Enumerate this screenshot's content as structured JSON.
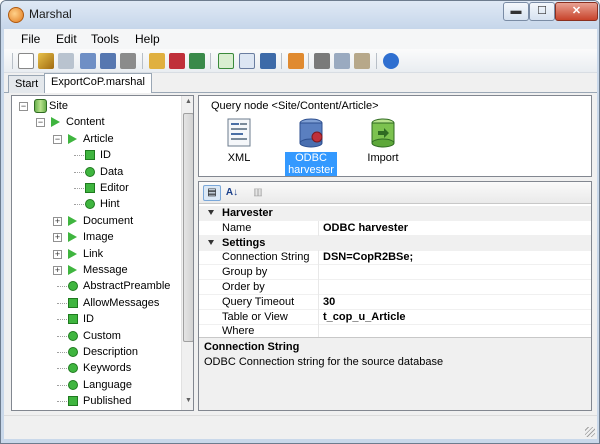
{
  "window": {
    "title": "Marshal",
    "minimize_glyph": "▬",
    "maximize_glyph": "☐",
    "close_glyph": "✕"
  },
  "menu": [
    "File",
    "Edit",
    "Tools",
    "Help"
  ],
  "toolbar_icons": [
    "new-icon",
    "wand-icon",
    "open-icon",
    "save-icon",
    "save-all-icon",
    "print-icon",
    "settings-icon",
    "cube-run-icon",
    "forward-icon",
    "export-xml-icon",
    "export-icon",
    "console-icon",
    "configure-icon",
    "cut-icon",
    "copy-icon",
    "paste-icon",
    "help-icon"
  ],
  "tabs": [
    "Start",
    "ExportCoP.marshal"
  ],
  "tree": {
    "items": [
      {
        "label": "Site",
        "icon": "database-icon",
        "level": 0,
        "expander": "−"
      },
      {
        "label": "Content",
        "icon": "play-icon",
        "level": 1,
        "expander": "−"
      },
      {
        "label": "Article",
        "icon": "play-icon",
        "level": 2,
        "expander": "−"
      },
      {
        "label": "ID",
        "icon": "square-icon",
        "level": 3,
        "expander": ""
      },
      {
        "label": "Data",
        "icon": "dot-icon",
        "level": 3,
        "expander": ""
      },
      {
        "label": "Editor",
        "icon": "square-icon",
        "level": 3,
        "expander": ""
      },
      {
        "label": "Hint",
        "icon": "dot-icon",
        "level": 3,
        "expander": ""
      },
      {
        "label": "Document",
        "icon": "play-icon",
        "level": 2,
        "expander": "+"
      },
      {
        "label": "Image",
        "icon": "play-icon",
        "level": 2,
        "expander": "+"
      },
      {
        "label": "Link",
        "icon": "play-icon",
        "level": 2,
        "expander": "+"
      },
      {
        "label": "Message",
        "icon": "play-icon",
        "level": 2,
        "expander": "+"
      },
      {
        "label": "AbstractPreamble",
        "icon": "dot-icon",
        "level": 2,
        "expander": ""
      },
      {
        "label": "AllowMessages",
        "icon": "square-icon",
        "level": 2,
        "expander": ""
      },
      {
        "label": "ID",
        "icon": "square-icon",
        "level": 2,
        "expander": ""
      },
      {
        "label": "Custom",
        "icon": "dot-icon",
        "level": 2,
        "expander": ""
      },
      {
        "label": "Description",
        "icon": "dot-icon",
        "level": 2,
        "expander": ""
      },
      {
        "label": "Keywords",
        "icon": "dot-icon",
        "level": 2,
        "expander": ""
      },
      {
        "label": "Language",
        "icon": "dot-icon",
        "level": 2,
        "expander": ""
      },
      {
        "label": "Published",
        "icon": "square-icon",
        "level": 2,
        "expander": ""
      }
    ],
    "scroll_up_glyph": "▲",
    "scroll_down_glyph": "▼"
  },
  "query_node": {
    "title": "Query node <Site/Content/Article>",
    "items": [
      {
        "label": "XML",
        "icon": "xml-document-icon",
        "selected": false
      },
      {
        "label": "ODBC harvester",
        "icon": "odbc-database-icon",
        "selected": true
      },
      {
        "label": "Import",
        "icon": "import-database-icon",
        "selected": false
      }
    ]
  },
  "property_grid": {
    "toolbar": {
      "categorized_glyph": "▤",
      "alphabetical_glyph": "A↓",
      "pages_glyph": "▥"
    },
    "rows": [
      {
        "type": "category",
        "label": "Harvester"
      },
      {
        "type": "property",
        "name": "Name",
        "value": "ODBC harvester"
      },
      {
        "type": "category",
        "label": "Settings"
      },
      {
        "type": "property",
        "name": "Connection String",
        "value": "DSN=CopR2BSe;"
      },
      {
        "type": "property",
        "name": "Group by",
        "value": ""
      },
      {
        "type": "property",
        "name": "Order by",
        "value": ""
      },
      {
        "type": "property",
        "name": "Query Timeout",
        "value": "30"
      },
      {
        "type": "property",
        "name": "Table or View",
        "value": "t_cop_u_Article"
      },
      {
        "type": "property",
        "name": "Where",
        "value": ""
      }
    ],
    "description": {
      "title": "Connection String",
      "text": "ODBC Connection string for the source database"
    }
  },
  "colors": {
    "accent_green": "#3fb53f",
    "selection_blue": "#3399ff"
  }
}
